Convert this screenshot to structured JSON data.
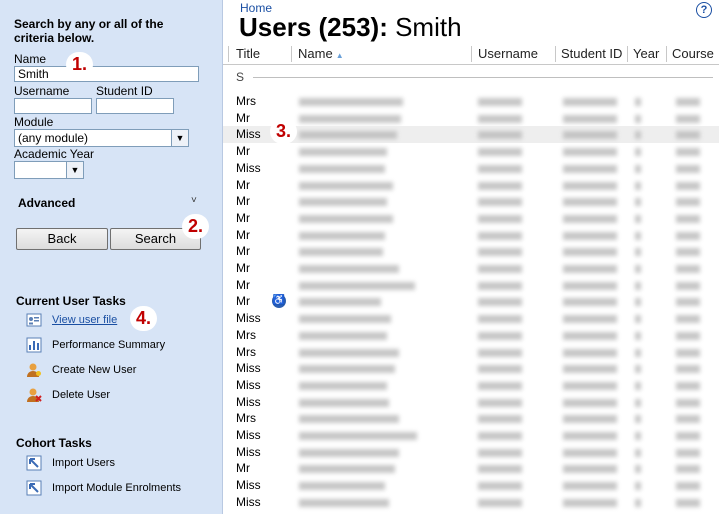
{
  "sidebar": {
    "heading": "Search by any or all of the criteria below.",
    "name_label": "Name",
    "name_value": "Smith",
    "username_label": "Username",
    "student_id_label": "Student ID",
    "module_label": "Module",
    "module_value": "(any module)",
    "academic_year_label": "Academic Year",
    "academic_year_value": "",
    "advanced_label": "Advanced",
    "back_label": "Back",
    "search_label": "Search",
    "current_tasks_title": "Current User Tasks",
    "tasks": [
      {
        "label": "View user file",
        "icon": "user-file-icon"
      },
      {
        "label": "Performance Summary",
        "icon": "bar-chart-icon"
      },
      {
        "label": "Create New User",
        "icon": "add-user-icon"
      },
      {
        "label": "Delete User",
        "icon": "delete-user-icon"
      }
    ],
    "cohort_tasks_title": "Cohort Tasks",
    "cohort_tasks": [
      {
        "label": "Import Users",
        "icon": "import-arrow-icon"
      },
      {
        "label": "Import Module Enrolments",
        "icon": "import-arrow-icon"
      }
    ]
  },
  "annotations": [
    "1.",
    "2.",
    "3.",
    "4."
  ],
  "main": {
    "breadcrumb": "Home",
    "help_glyph": "?",
    "title_prefix": "Users (253):",
    "title_query": "Smith",
    "columns": [
      "Title",
      "Name",
      "Username",
      "Student ID",
      "Year",
      "Course"
    ],
    "letter": "S",
    "rows": [
      {
        "title": "Mrs"
      },
      {
        "title": "Mr"
      },
      {
        "title": "Miss"
      },
      {
        "title": "Mr"
      },
      {
        "title": "Miss"
      },
      {
        "title": "Mr"
      },
      {
        "title": "Mr"
      },
      {
        "title": "Mr"
      },
      {
        "title": "Mr"
      },
      {
        "title": "Mr"
      },
      {
        "title": "Mr"
      },
      {
        "title": "Mr"
      },
      {
        "title": "Mr"
      },
      {
        "title": "Miss"
      },
      {
        "title": "Mrs"
      },
      {
        "title": "Mrs"
      },
      {
        "title": "Miss"
      },
      {
        "title": "Miss"
      },
      {
        "title": "Miss"
      },
      {
        "title": "Mrs"
      },
      {
        "title": "Miss"
      },
      {
        "title": "Miss"
      },
      {
        "title": "Mr"
      },
      {
        "title": "Miss"
      },
      {
        "title": "Miss"
      }
    ],
    "highlighted_row": 2,
    "accessibility_row": 12,
    "colors": {
      "accent": "#1a4fa3",
      "sidebar_bg": "#d7e4f6",
      "annotation": "#c00000"
    }
  }
}
